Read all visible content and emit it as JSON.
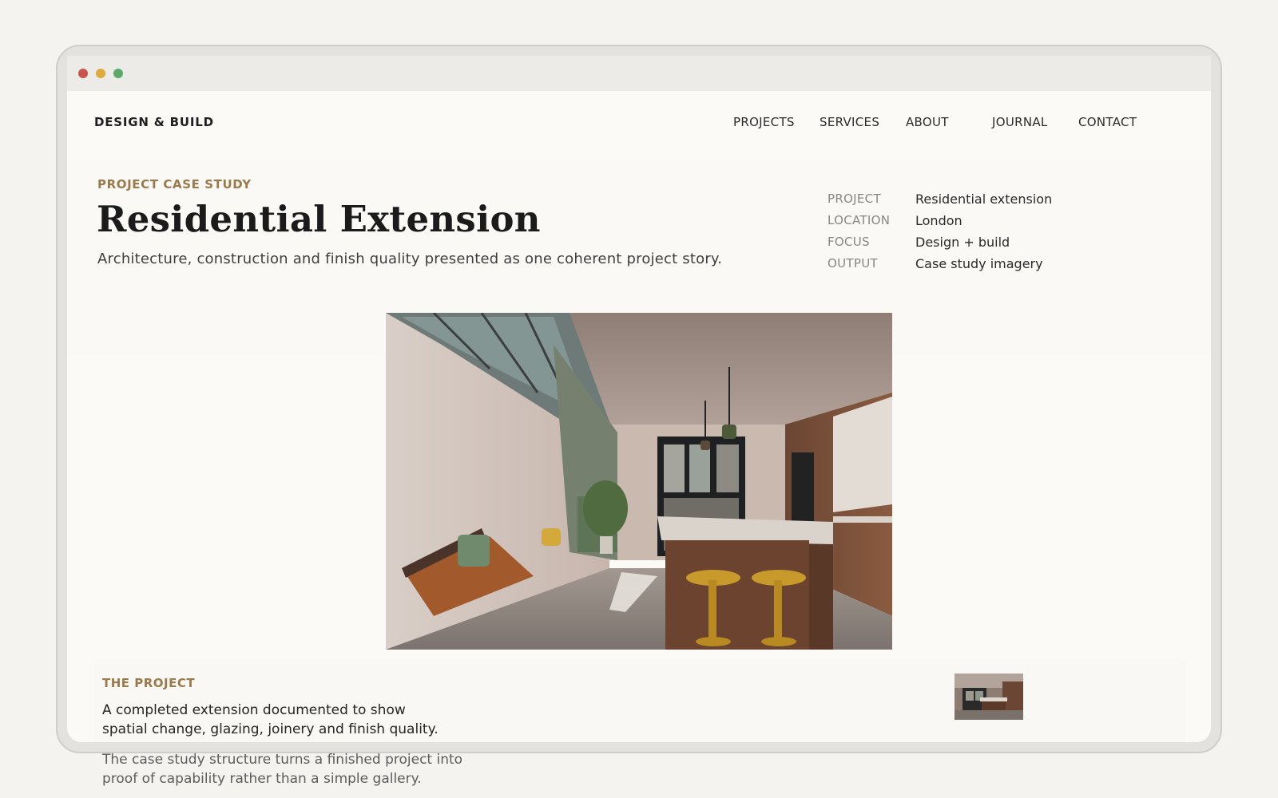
{
  "brand": "DESIGN & BUILD",
  "nav": [
    "PROJECTS",
    "SERVICES",
    "ABOUT",
    "JOURNAL",
    "CONTACT"
  ],
  "hero": {
    "eyebrow": "PROJECT CASE STUDY",
    "title": "Residential Extension",
    "subtitle": "Architecture, construction and finish quality presented as one coherent project story."
  },
  "meta": [
    {
      "label": "PROJECT",
      "value": "Residential extension"
    },
    {
      "label": "LOCATION",
      "value": "London"
    },
    {
      "label": "FOCUS",
      "value": "Design + build"
    },
    {
      "label": "OUTPUT",
      "value": "Case study imagery"
    }
  ],
  "section": {
    "eyebrow": "THE PROJECT",
    "lead_line1": "A completed extension documented to show",
    "lead_line2": "spatial change, glazing, joinery and finish quality.",
    "body_line1": "The case study structure turns a finished project into",
    "body_line2": "proof of capability rather than a simple gallery."
  },
  "colors": {
    "accent": "#9a7a4c",
    "background": "#f4f3f0",
    "window": "#fbfaf7"
  }
}
